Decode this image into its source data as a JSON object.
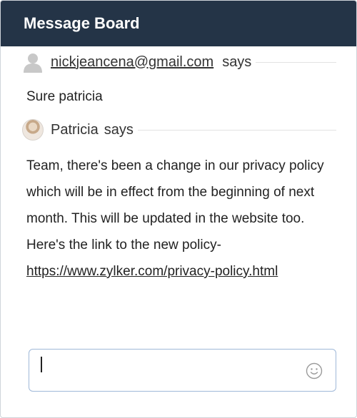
{
  "header": {
    "title": "Message Board"
  },
  "messages": [
    {
      "sender": "nickjeancena@gmail.com",
      "says": "says",
      "body": "Sure patricia"
    },
    {
      "sender": "Patricia",
      "says": "says",
      "body_text": "Team, there's been a change in our privacy policy which will be in effect from the beginning of next month. This will be updated in the website too. Here's the link to the new policy- ",
      "link": "https://www.zylker.com/privacy-policy.html"
    }
  ],
  "composer": {
    "value": "",
    "emoji_icon": "smiley-icon"
  },
  "colors": {
    "header_bg": "#243447",
    "composer_border": "#9fb8d8"
  }
}
